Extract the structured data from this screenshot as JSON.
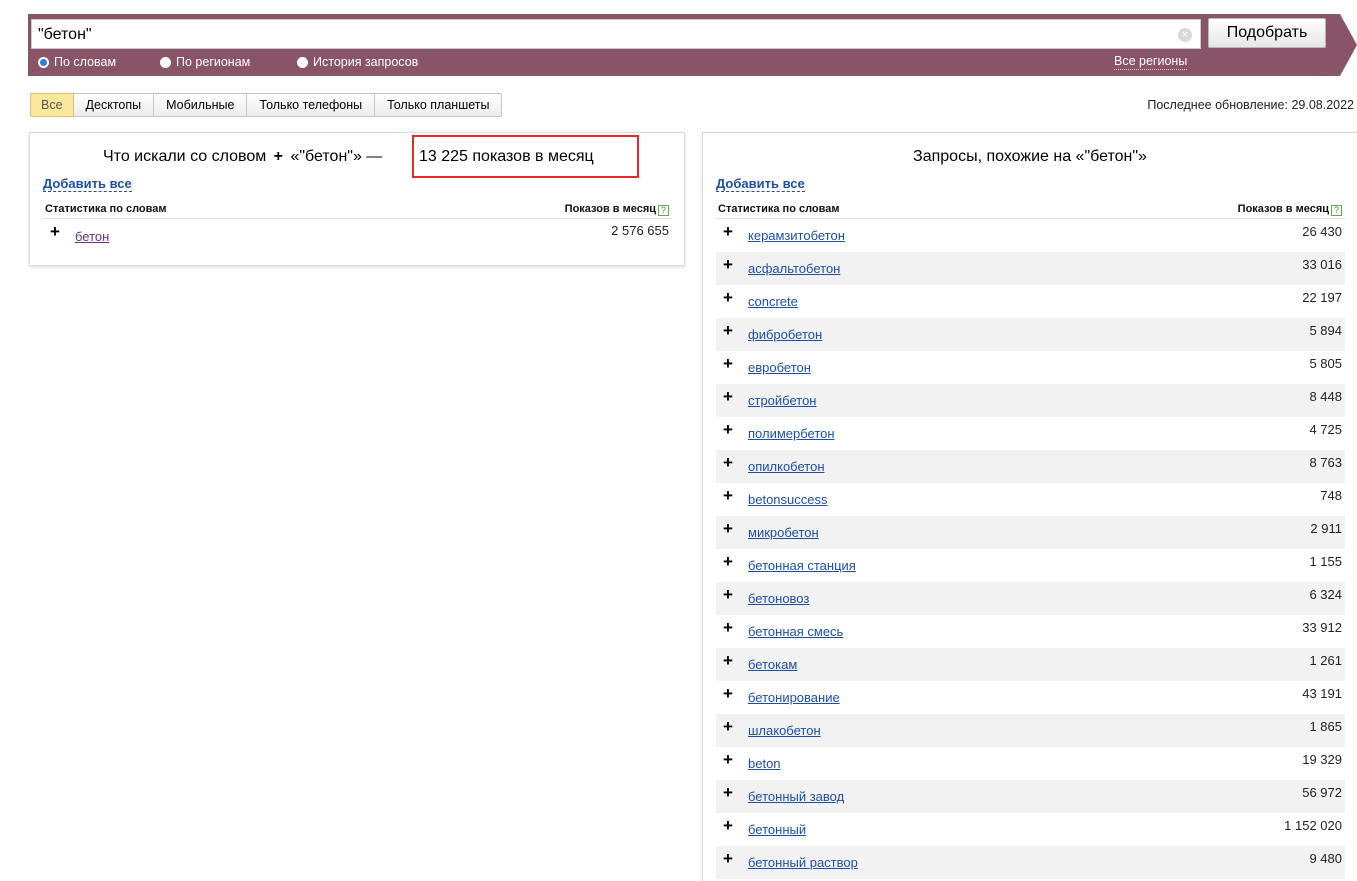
{
  "search": {
    "value": "\"бетон\"",
    "clear_icon": "clear-circle-icon",
    "submit_label": "Подобрать"
  },
  "modes": [
    {
      "label": "По словам",
      "selected": true
    },
    {
      "label": "По регионам",
      "selected": false
    },
    {
      "label": "История запросов",
      "selected": false
    }
  ],
  "regions_link": "Все регионы",
  "device_tabs": [
    {
      "label": "Все",
      "active": true
    },
    {
      "label": "Десктопы",
      "active": false
    },
    {
      "label": "Мобильные",
      "active": false
    },
    {
      "label": "Только телефоны",
      "active": false
    },
    {
      "label": "Только планшеты",
      "active": false
    }
  ],
  "last_update": "Последнее обновление: 29.08.2022",
  "left_panel": {
    "heading_prefix": "Что искали со словом",
    "heading_plus": "+",
    "heading_term": "«\"бетон\"» —",
    "shows_total": "13 225 показов в месяц",
    "add_all": "Добавить все",
    "col_words": "Статистика по словам",
    "col_shows": "Показов в месяц",
    "help_icon": "?",
    "rows": [
      {
        "plus": "+",
        "phrase": "бетон",
        "count": "2 576 655"
      }
    ]
  },
  "right_panel": {
    "heading": "Запросы, похожие на «\"бетон\"»",
    "add_all": "Добавить все",
    "col_words": "Статистика по словам",
    "col_shows": "Показов в месяц",
    "help_icon": "?",
    "rows": [
      {
        "plus": "+",
        "phrase": "керамзитобетон",
        "count": "26 430"
      },
      {
        "plus": "+",
        "phrase": "асфальтобетон",
        "count": "33 016"
      },
      {
        "plus": "+",
        "phrase": "concrete",
        "count": "22 197"
      },
      {
        "plus": "+",
        "phrase": "фибробетон",
        "count": "5 894"
      },
      {
        "plus": "+",
        "phrase": "евробетон",
        "count": "5 805"
      },
      {
        "plus": "+",
        "phrase": "стройбетон",
        "count": "8 448"
      },
      {
        "plus": "+",
        "phrase": "полимербетон",
        "count": "4 725"
      },
      {
        "plus": "+",
        "phrase": "опилкобетон",
        "count": "8 763"
      },
      {
        "plus": "+",
        "phrase": "betonsuccess",
        "count": "748"
      },
      {
        "plus": "+",
        "phrase": "микробетон",
        "count": "2 911"
      },
      {
        "plus": "+",
        "phrase": "бетонная станция",
        "count": "1 155"
      },
      {
        "plus": "+",
        "phrase": "бетоновоз",
        "count": "6 324"
      },
      {
        "plus": "+",
        "phrase": "бетонная смесь",
        "count": "33 912"
      },
      {
        "plus": "+",
        "phrase": "бетокам",
        "count": "1 261"
      },
      {
        "plus": "+",
        "phrase": "бетонирование",
        "count": "43 191"
      },
      {
        "plus": "+",
        "phrase": "шлакобетон",
        "count": "1 865"
      },
      {
        "plus": "+",
        "phrase": "beton",
        "count": "19 329"
      },
      {
        "plus": "+",
        "phrase": "бетонный завод",
        "count": "56 972"
      },
      {
        "plus": "+",
        "phrase": "бетонный",
        "count": "1 152 020"
      },
      {
        "plus": "+",
        "phrase": "бетонный раствор",
        "count": "9 480"
      }
    ]
  }
}
